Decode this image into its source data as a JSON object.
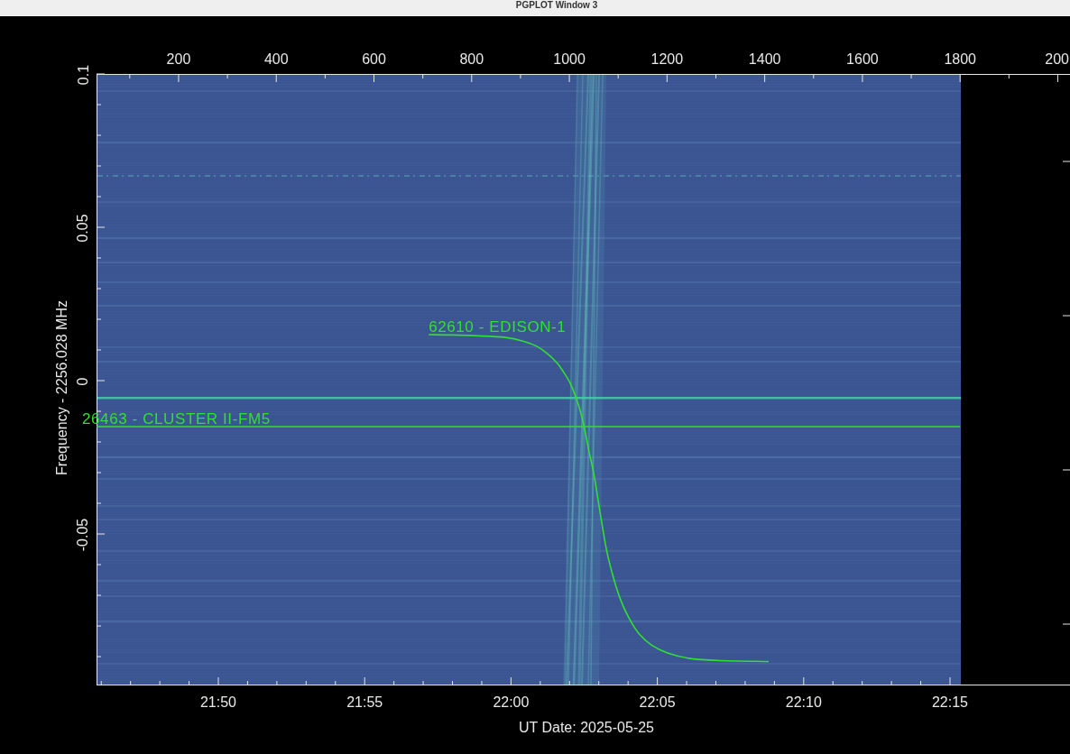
{
  "window": {
    "title": "PGPLOT Window 3"
  },
  "plot": {
    "top_axis_edge_label": "200",
    "bottom_axis": {
      "title": "UT Date: 2025-05-25",
      "labels": [
        "21:50",
        "21:55",
        "22:00",
        "22:05",
        "22:10",
        "22:15"
      ]
    },
    "chart_data": {
      "type": "line",
      "ylabel": "Frequency - 2256.028 MHz",
      "x": [
        32,
        712,
        758,
        813,
        869,
        905,
        933,
        955,
        974,
        989,
        1002,
        1013,
        1022,
        1031,
        1040,
        1050,
        1059,
        1068,
        1077,
        1090,
        1105,
        1122,
        1142,
        1168,
        1201,
        1247,
        1312,
        1408,
        1800
      ],
      "series": [
        {
          "name": "62610 - EDISON-1",
          "color": "#30e030",
          "values": [
            null,
            0.015,
            0.0149,
            0.0146,
            0.0141,
            0.0129,
            0.0112,
            0.0088,
            0.0059,
            0.0026,
            -0.0009,
            -0.0053,
            -0.0097,
            -0.0156,
            -0.0229,
            -0.0303,
            -0.0391,
            -0.0479,
            -0.0559,
            -0.0641,
            -0.0715,
            -0.0774,
            -0.0824,
            -0.0862,
            -0.0888,
            -0.0906,
            -0.0913,
            -0.0916,
            null
          ]
        },
        {
          "name": "26463 - CLUSTER II-FM5",
          "color": "#30e030",
          "values": [
            -0.015,
            -0.015,
            -0.015,
            -0.015,
            -0.015,
            -0.015,
            -0.015,
            -0.015,
            -0.015,
            -0.015,
            -0.015,
            -0.015,
            -0.015,
            -0.015,
            -0.015,
            -0.015,
            -0.015,
            -0.015,
            -0.015,
            -0.015,
            -0.015,
            -0.015,
            -0.015,
            -0.015,
            -0.015,
            -0.015,
            -0.015,
            -0.015,
            -0.015
          ]
        }
      ],
      "xlim": [
        32,
        2025
      ],
      "ylim": [
        -0.0994,
        0.1
      ],
      "xticks": [
        200,
        400,
        600,
        800,
        1000,
        1200,
        1400,
        1600,
        1800
      ],
      "yticks": [
        {
          "value": -0.05,
          "label": "-0.05"
        },
        {
          "value": 0,
          "label": "0"
        },
        {
          "value": 0.05,
          "label": "0.05"
        },
        {
          "value": 0.1,
          "label": "0.1"
        }
      ]
    }
  }
}
